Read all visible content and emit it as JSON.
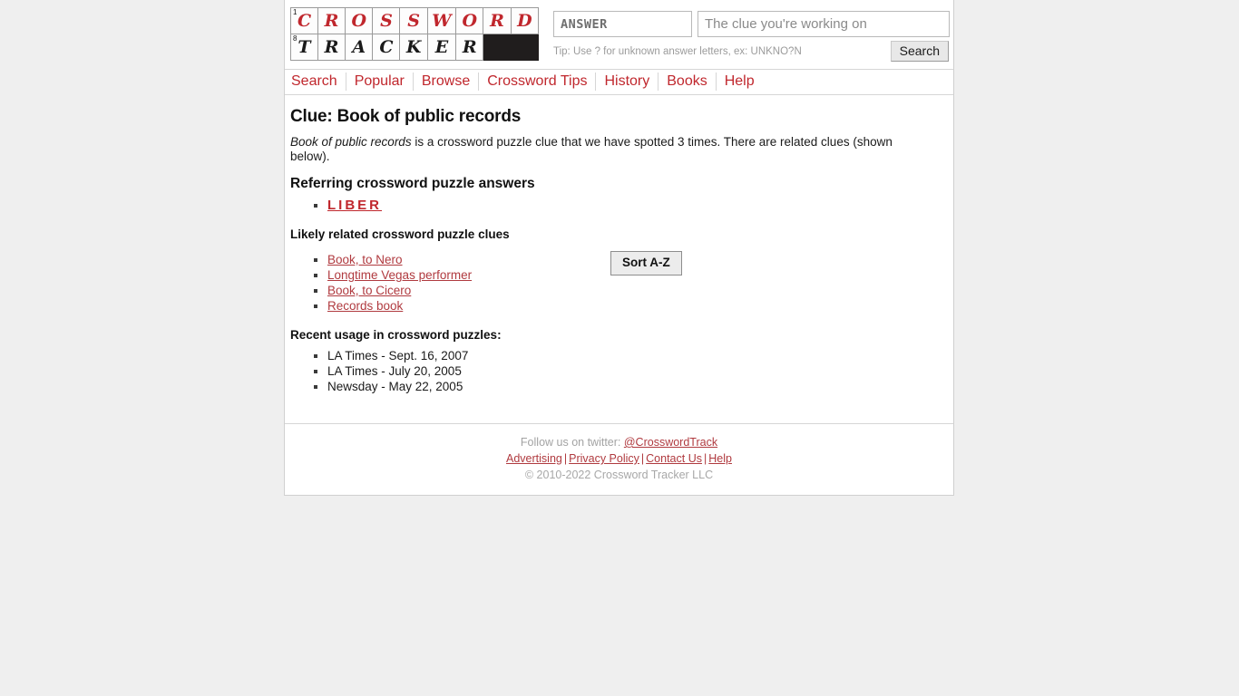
{
  "logo": {
    "row1": [
      {
        "num": "1",
        "ch": "C"
      },
      {
        "num": "",
        "ch": "R"
      },
      {
        "num": "",
        "ch": "O"
      },
      {
        "num": "",
        "ch": "S"
      },
      {
        "num": "",
        "ch": "S"
      },
      {
        "num": "",
        "ch": "W"
      },
      {
        "num": "",
        "ch": "O"
      },
      {
        "num": "",
        "ch": "R"
      },
      {
        "num": "",
        "ch": "D"
      }
    ],
    "row2": [
      {
        "num": "8",
        "ch": "T"
      },
      {
        "num": "",
        "ch": "R"
      },
      {
        "num": "",
        "ch": "A"
      },
      {
        "num": "",
        "ch": "C"
      },
      {
        "num": "",
        "ch": "K"
      },
      {
        "num": "",
        "ch": "E"
      },
      {
        "num": "",
        "ch": "R"
      },
      {
        "num": "",
        "ch": "",
        "black": true
      },
      {
        "num": "",
        "ch": "",
        "black": true
      }
    ]
  },
  "search": {
    "answer_value": "",
    "answer_placeholder": "ANSWER",
    "clue_value": "",
    "clue_placeholder": "The clue you're working on",
    "tip": "Tip: Use ? for unknown answer letters, ex: UNKNO?N",
    "button_label": "Search"
  },
  "nav": {
    "items": [
      {
        "label": "Search"
      },
      {
        "label": "Popular"
      },
      {
        "label": "Browse"
      },
      {
        "label": "Crossword Tips"
      },
      {
        "label": "History"
      },
      {
        "label": "Books"
      },
      {
        "label": "Help"
      }
    ]
  },
  "main": {
    "title": "Clue: Book of public records",
    "intro_emphasis": "Book of public records",
    "intro_rest": " is a crossword puzzle clue that we have spotted 3 times. There are related clues (shown below).",
    "answers_heading": "Referring crossword puzzle answers",
    "answers": [
      {
        "label": "LIBER"
      }
    ],
    "related_heading": "Likely related crossword puzzle clues",
    "related": [
      {
        "label": "Book, to Nero"
      },
      {
        "label": "Longtime Vegas performer"
      },
      {
        "label": "Book, to Cicero"
      },
      {
        "label": "Records book"
      }
    ],
    "sort_button_label": "Sort A-Z",
    "usage_heading": "Recent usage in crossword puzzles:",
    "usage": [
      {
        "label": "LA Times - Sept. 16, 2007"
      },
      {
        "label": "LA Times - July 20, 2005"
      },
      {
        "label": "Newsday - May 22, 2005"
      }
    ]
  },
  "footer": {
    "twitter_prefix": "Follow us on twitter: ",
    "twitter_handle": "@CrosswordTrack",
    "links": [
      {
        "label": "Advertising"
      },
      {
        "label": "Privacy Policy"
      },
      {
        "label": "Contact Us"
      },
      {
        "label": "Help"
      }
    ],
    "separator": "|",
    "copyright": "© 2010-2022 Crossword Tracker LLC"
  },
  "colors": {
    "brand_red": "#c0272d",
    "link_red": "#b03a3f",
    "page_bg": "#efefef"
  }
}
